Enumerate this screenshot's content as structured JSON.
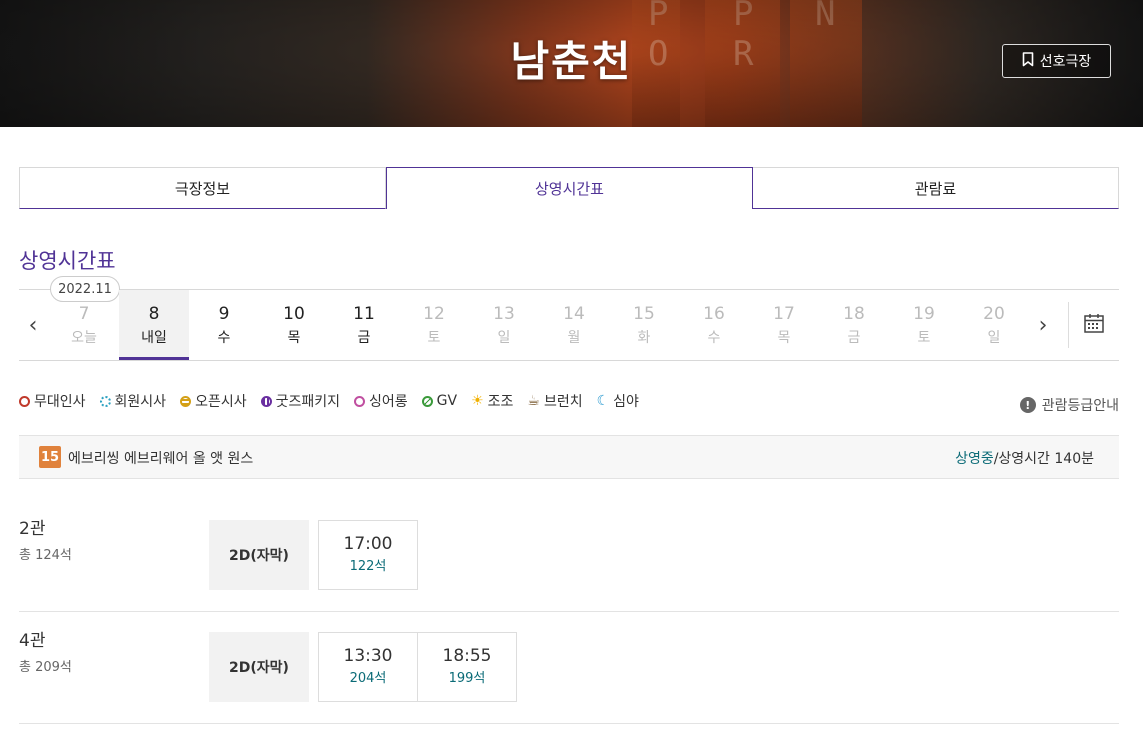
{
  "header": {
    "title": "남춘천",
    "favorite_label": "선호극장"
  },
  "tabs": [
    {
      "label": "극장정보"
    },
    {
      "label": "상영시간표"
    },
    {
      "label": "관람료"
    }
  ],
  "section_title": "상영시간표",
  "date_bar": {
    "month": "2022.11",
    "days": [
      {
        "num": "7",
        "dow": "오늘"
      },
      {
        "num": "8",
        "dow": "내일"
      },
      {
        "num": "9",
        "dow": "수"
      },
      {
        "num": "10",
        "dow": "목"
      },
      {
        "num": "11",
        "dow": "금"
      },
      {
        "num": "12",
        "dow": "토"
      },
      {
        "num": "13",
        "dow": "일"
      },
      {
        "num": "14",
        "dow": "월"
      },
      {
        "num": "15",
        "dow": "화"
      },
      {
        "num": "16",
        "dow": "수"
      },
      {
        "num": "17",
        "dow": "목"
      },
      {
        "num": "18",
        "dow": "금"
      },
      {
        "num": "19",
        "dow": "토"
      },
      {
        "num": "20",
        "dow": "일"
      }
    ]
  },
  "legend": [
    {
      "label": "무대인사",
      "color": "#c0392b"
    },
    {
      "label": "회원시사",
      "color": "#2aa0c0"
    },
    {
      "label": "오픈시사",
      "color": "#d4a017"
    },
    {
      "label": "굿즈패키지",
      "color": "#6a2fa0"
    },
    {
      "label": "싱어롱",
      "color": "#c04fa0"
    },
    {
      "label": "GV",
      "color": "#3a9a3a"
    },
    {
      "label": "조조",
      "color": "#f0b000"
    },
    {
      "label": "브런치",
      "color": "#7a5a30"
    },
    {
      "label": "심야",
      "color": "#2a9ad0"
    }
  ],
  "rating_guide": "관람등급안내",
  "movie": {
    "age": "15",
    "title": "에브리씽 에브리웨어 올 앳 원스",
    "status": "상영중",
    "runtime": "/상영시간 140분"
  },
  "halls": [
    {
      "name": "2관",
      "seats": "총 124석",
      "format": "2D(자막)",
      "slots": [
        {
          "time": "17:00",
          "remain": "122석"
        }
      ]
    },
    {
      "name": "4관",
      "seats": "총 209석",
      "format": "2D(자막)",
      "slots": [
        {
          "time": "13:30",
          "remain": "204석"
        },
        {
          "time": "18:55",
          "remain": "199석"
        }
      ]
    }
  ]
}
